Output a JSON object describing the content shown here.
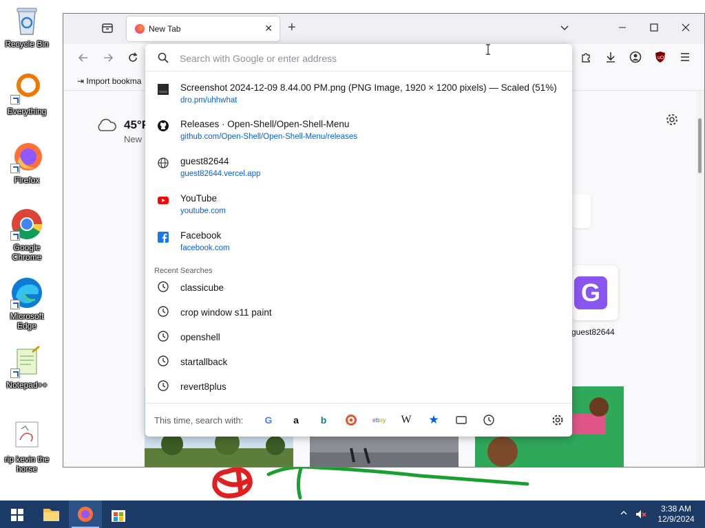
{
  "desktop": {
    "icons": [
      {
        "label": "Recycle Bin"
      },
      {
        "label": "Everything"
      },
      {
        "label": "Firefox"
      },
      {
        "label": "Google Chrome"
      },
      {
        "label": "Microsoft Edge"
      },
      {
        "label": "Notepad++"
      },
      {
        "label": "rip kevin the horse"
      }
    ]
  },
  "browser": {
    "tab": {
      "title": "New Tab"
    },
    "bookmarks_toolbar": {
      "import_label": "Import bookma"
    },
    "newtab": {
      "weather": {
        "temp": "45°F",
        "location": "New"
      },
      "shortcut_label": "guest82644"
    },
    "urlbar": {
      "placeholder": "Search with Google or enter address",
      "value": "",
      "results": [
        {
          "title": "Screenshot 2024-12-09 8.44.00 PM.png (PNG Image, 1920 × 1200 pixels) — Scaled (51%)",
          "url": "dro.pm/uhhwhat",
          "icon": "image-thumbnail-icon"
        },
        {
          "title": "Releases · Open-Shell/Open-Shell-Menu",
          "url": "github.com/Open-Shell/Open-Shell-Menu/releases",
          "icon": "github-icon"
        },
        {
          "title": "guest82644",
          "url": "guest82644.vercel.app",
          "icon": "globe-icon"
        },
        {
          "title": "YouTube",
          "url": "youtube.com",
          "icon": "youtube-icon"
        },
        {
          "title": "Facebook",
          "url": "facebook.com",
          "icon": "facebook-icon"
        }
      ],
      "recent_header": "Recent Searches",
      "recent": [
        {
          "text": "classicube"
        },
        {
          "text": "crop window s11 paint"
        },
        {
          "text": "openshell"
        },
        {
          "text": "startallback"
        },
        {
          "text": "revert8plus"
        }
      ],
      "engines_label": "This time, search with:",
      "engines": [
        "Google",
        "Amazon",
        "Bing",
        "DuckDuckGo",
        "eBay",
        "Wikipedia",
        "Bookmarks",
        "Tabs",
        "History"
      ]
    }
  },
  "taskbar": {
    "time": "3:38 AM",
    "date": "12/9/2024"
  },
  "colors": {
    "link": "#0061e0",
    "taskbar": "#1c3a66",
    "scribble_red": "#e02020",
    "scribble_green": "#1aa030"
  }
}
